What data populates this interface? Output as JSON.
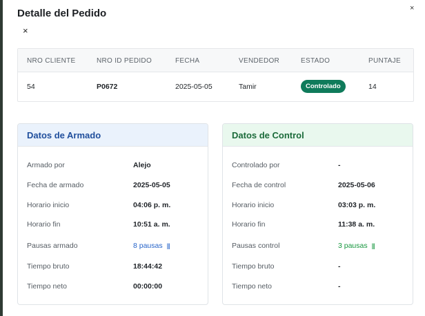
{
  "modal": {
    "title": "Detalle del Pedido",
    "close_top": "×",
    "close_sub": "×"
  },
  "summary": {
    "headers": [
      "NRO CLIENTE",
      "NRO ID PEDIDO",
      "FECHA",
      "VENDEDOR",
      "ESTADO",
      "PUNTAJE"
    ],
    "row": {
      "cliente": "54",
      "pedido": "P0672",
      "fecha": "2025-05-05",
      "vendedor": "Tamir",
      "estado": "Controlado",
      "puntaje": "14"
    },
    "estado_color": "#0f7b5b"
  },
  "armado": {
    "title": "Datos de Armado",
    "accent": "#1f4e9c",
    "rows": [
      {
        "label": "Armado por",
        "value": "Alejo"
      },
      {
        "label": "Fecha de armado",
        "value": "2025-05-05"
      },
      {
        "label": "Horario inicio",
        "value": "04:06 p. m."
      },
      {
        "label": "Horario fin",
        "value": "10:51 a. m."
      },
      {
        "label": "Pausas armado",
        "value": "8 pausas"
      },
      {
        "label": "Tiempo bruto",
        "value": "18:44:42"
      },
      {
        "label": "Tiempo neto",
        "value": "00:00:00"
      }
    ]
  },
  "control": {
    "title": "Datos de Control",
    "accent": "#1b6b3a",
    "rows": [
      {
        "label": "Controlado por",
        "value": "-"
      },
      {
        "label": "Fecha de control",
        "value": "2025-05-06"
      },
      {
        "label": "Horario inicio",
        "value": "03:03 p. m."
      },
      {
        "label": "Horario fin",
        "value": "11:38 a. m."
      },
      {
        "label": "Pausas control",
        "value": "3 pausas"
      },
      {
        "label": "Tiempo bruto",
        "value": "-"
      },
      {
        "label": "Tiempo neto",
        "value": "-"
      }
    ]
  },
  "icons": {
    "pause_icon": "pause-bars-icon",
    "close_icon": "close-icon"
  }
}
